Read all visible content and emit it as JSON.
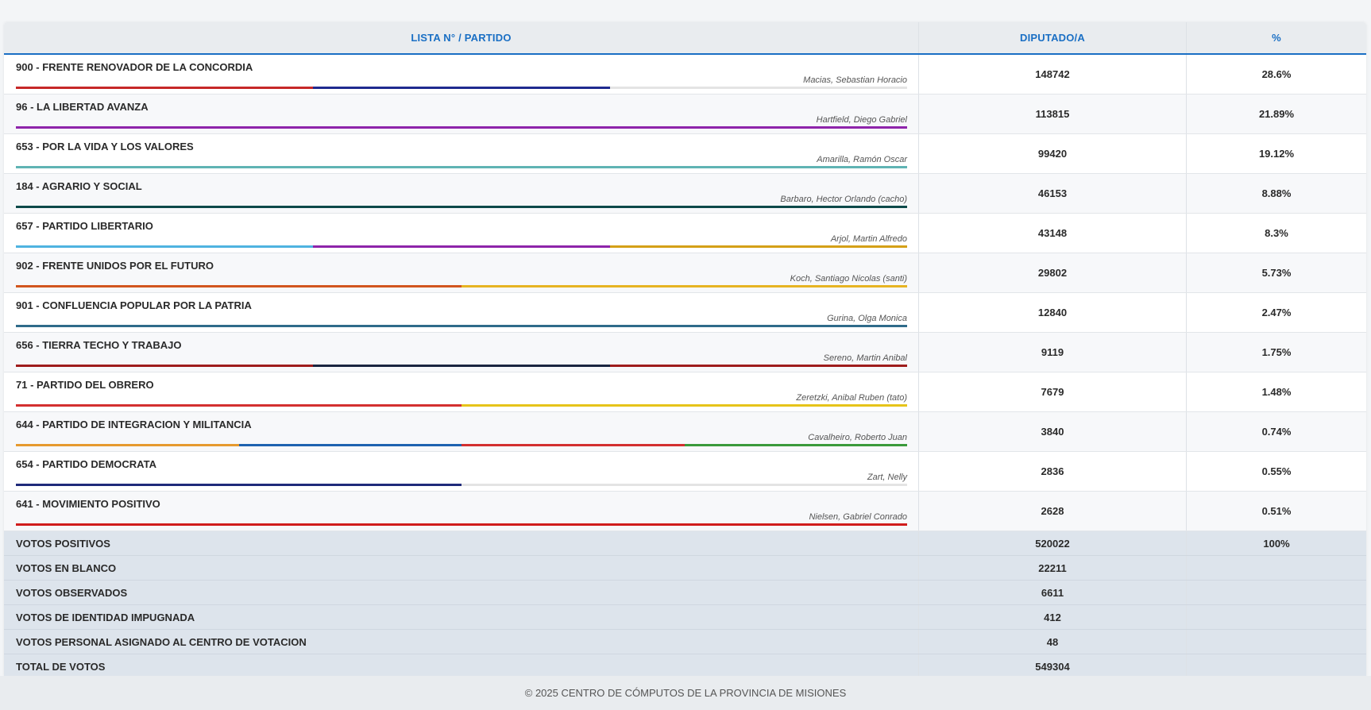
{
  "header": {
    "col_party": "LISTA N° / PARTIDO",
    "col_candidate": "DIPUTADO/A",
    "col_percent": "%"
  },
  "rows": [
    {
      "party": "900 - FRENTE RENOVADOR DE LA CONCORDIA",
      "candidate": "Macias, Sebastian Horacio",
      "votes": "148742",
      "percent": "28.6%",
      "colors": [
        "#c62828",
        "#1f2a8f",
        "#e4e4e4"
      ]
    },
    {
      "party": "96 - LA LIBERTAD AVANZA",
      "candidate": "Hartfield, Diego Gabriel",
      "votes": "113815",
      "percent": "21.89%",
      "colors": [
        "#8e24aa"
      ]
    },
    {
      "party": "653 - POR LA VIDA Y LOS VALORES",
      "candidate": "Amarilla, Ramón Oscar",
      "votes": "99420",
      "percent": "19.12%",
      "colors": [
        "#5fb3b3"
      ]
    },
    {
      "party": "184 - AGRARIO Y SOCIAL",
      "candidate": "Barbaro, Hector Orlando (cacho)",
      "votes": "46153",
      "percent": "8.88%",
      "colors": [
        "#0d4a4a"
      ]
    },
    {
      "party": "657 - PARTIDO LIBERTARIO",
      "candidate": "Arjol, Martin Alfredo",
      "votes": "43148",
      "percent": "8.3%",
      "colors": [
        "#4fb3e0",
        "#8e24aa",
        "#d4a017"
      ]
    },
    {
      "party": "902 - FRENTE UNIDOS POR EL FUTURO",
      "candidate": "Koch, Santiago Nicolas (santi)",
      "votes": "29802",
      "percent": "5.73%",
      "colors": [
        "#d2561e",
        "#e6b422"
      ]
    },
    {
      "party": "901 - CONFLUENCIA POPULAR POR LA PATRIA",
      "candidate": "Gurina, Olga Monica",
      "votes": "12840",
      "percent": "2.47%",
      "colors": [
        "#2f6b8a"
      ]
    },
    {
      "party": "656 - TIERRA TECHO Y TRABAJO",
      "candidate": "Sereno, Martin Anibal",
      "votes": "9119",
      "percent": "1.75%",
      "colors": [
        "#9e1c1c",
        "#1a2540",
        "#9e1c1c"
      ]
    },
    {
      "party": "71 - PARTIDO DEL OBRERO",
      "candidate": "Zeretzki, Anibal Ruben (tato)",
      "votes": "7679",
      "percent": "1.48%",
      "colors": [
        "#d32f2f",
        "#e6c419"
      ]
    },
    {
      "party": "644 - PARTIDO DE INTEGRACION Y MILITANCIA",
      "candidate": "Cavalheiro, Roberto Juan",
      "votes": "3840",
      "percent": "0.74%",
      "colors": [
        "#e69a2e",
        "#1e62b0",
        "#d32f2f",
        "#3a9a3a"
      ]
    },
    {
      "party": "654 - PARTIDO DEMOCRATA",
      "candidate": "Zart, Nelly",
      "votes": "2836",
      "percent": "0.55%",
      "colors": [
        "#1f2a7a",
        "#e4e4e4"
      ]
    },
    {
      "party": "641 - MOVIMIENTO POSITIVO",
      "candidate": "Nielsen, Gabriel Conrado",
      "votes": "2628",
      "percent": "0.51%",
      "colors": [
        "#d01c1c"
      ]
    }
  ],
  "totals": [
    {
      "label": "VOTOS POSITIVOS",
      "votes": "520022",
      "percent": "100%"
    },
    {
      "label": "VOTOS EN BLANCO",
      "votes": "22211",
      "percent": ""
    },
    {
      "label": "VOTOS OBSERVADOS",
      "votes": "6611",
      "percent": ""
    },
    {
      "label": "VOTOS DE IDENTIDAD IMPUGNADA",
      "votes": "412",
      "percent": ""
    },
    {
      "label": "VOTOS PERSONAL ASIGNADO AL CENTRO DE VOTACION",
      "votes": "48",
      "percent": ""
    },
    {
      "label": "TOTAL DE VOTOS",
      "votes": "549304",
      "percent": ""
    }
  ],
  "footer": {
    "text": "© 2025 CENTRO DE CÓMPUTOS DE LA PROVINCIA DE MISIONES"
  }
}
